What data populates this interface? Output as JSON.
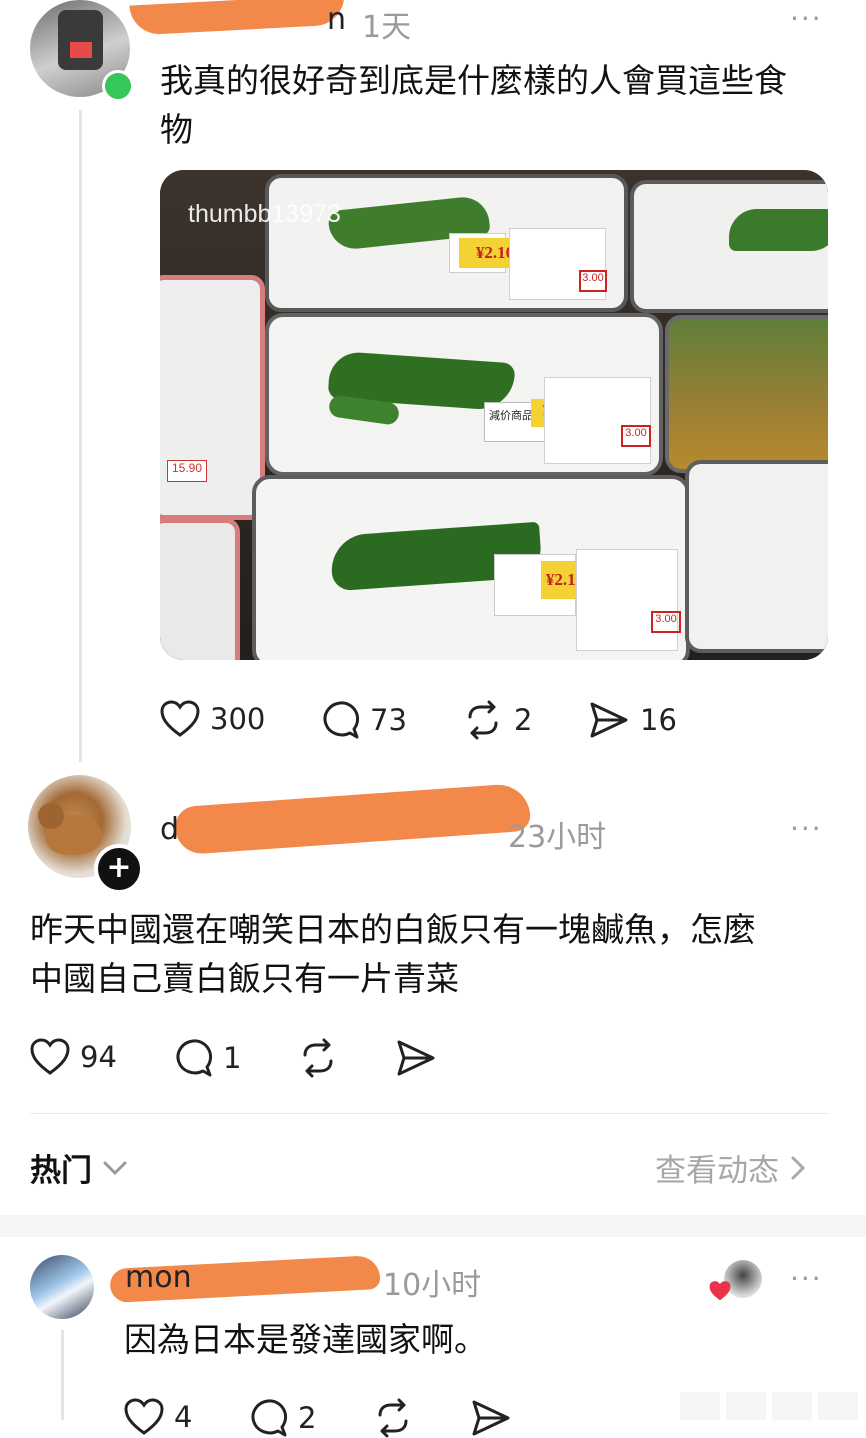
{
  "post1": {
    "handle_visible": "n",
    "time": "1天",
    "more": "···",
    "text_line1": "我真的很好奇到底是什麼樣的人會買這些食",
    "text_line2": "物",
    "image_watermark": "thumbb13973",
    "price_tag": "¥2.10",
    "sale_label": "減价商品",
    "orig_price": "3.00",
    "side_price": "15.90",
    "likes": "300",
    "comments": "73",
    "reposts": "2",
    "shares": "16"
  },
  "post2": {
    "handle_visible": "d",
    "time": "23小时",
    "more": "···",
    "text_line1": "昨天中國還在嘲笑日本的白飯只有一塊鹹魚，怎麼",
    "text_line2": "中國自己賣白飯只有一片青菜",
    "likes": "94",
    "comments": "1"
  },
  "section": {
    "title": "热门",
    "view_link": "查看动态"
  },
  "post3": {
    "handle_visible": "mon",
    "time": "10小时",
    "more": "···",
    "text": "因為日本是發達國家啊。",
    "likes": "4",
    "comments": "2"
  },
  "colors": {
    "redaction": "#f3884b",
    "online_dot": "#35c759",
    "heart_badge": "#e8334a"
  }
}
